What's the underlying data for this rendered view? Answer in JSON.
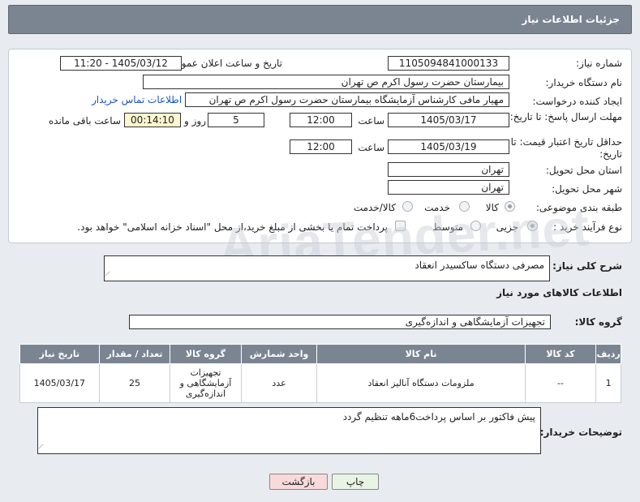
{
  "header": {
    "title": "جزئیات اطلاعات نیاز"
  },
  "form": {
    "need_number_label": "شماره نیاز:",
    "need_number": "1105094841000133",
    "announce_label": "تاریخ و ساعت اعلان عمومی:",
    "announce_value": "1405/03/12 - 11:20",
    "buyer_org_label": "نام دستگاه خریدار:",
    "buyer_org": "بیمارستان حضرت رسول اکرم ص  تهران",
    "creator_label": "ایجاد کننده درخواست:",
    "creator": "مهیار مافی کارشناس آزمایشگاه بیمارستان حضرت رسول اکرم ص  تهران",
    "contact_link": "اطلاعات تماس خریدار",
    "reply_deadline_label": "مهلت ارسال پاسخ: تا تاریخ:",
    "reply_date": "1405/03/17",
    "time_label": "ساعت",
    "reply_time": "12:00",
    "days": "5",
    "days_label": "روز و",
    "remaining": "00:14:10",
    "remaining_label": "ساعت باقی مانده",
    "price_valid_label": "حداقل تاریخ اعتبار قیمت: تا تاریخ:",
    "price_valid_date": "1405/03/19",
    "price_valid_time": "12:00",
    "province_label": "استان محل تحویل:",
    "province": "تهران",
    "city_label": "شهر محل تحویل:",
    "city": "تهران",
    "category_label": "طبقه بندی موضوعی:",
    "category_options": [
      "کالا",
      "خدمت",
      "کالا/خدمت"
    ],
    "process_label": "نوع فرآیند خرید :",
    "process_options": [
      "جزیی",
      "متوسط"
    ],
    "payment_note": "پرداخت تمام یا بخشی از مبلغ خرید،از محل \"اسناد خزانه اسلامی\" خواهد بود."
  },
  "watermark": "AriaTender.net",
  "summary": {
    "label": "شرح کلی نیاز:",
    "text": "مصرفی دستگاه ساکسیدر انعقاد"
  },
  "goods_section_title": "اطلاعات کالاهای مورد نیاز",
  "goods_group": {
    "label": "گروه کالا:",
    "value": "تجهیزات آزمایشگاهی و اندازه‌گیری"
  },
  "table": {
    "headers": [
      "ردیف",
      "کد کالا",
      "نام کالا",
      "واحد شمارش",
      "گروه کالا",
      "تعداد / مقدار",
      "تاریخ نیاز"
    ],
    "rows": [
      [
        "1",
        "--",
        "ملزومات دستگاه آنالیز انعقاد",
        "عدد",
        "تجهیزات آزمایشگاهی و اندازه‌گیری",
        "25",
        "1405/03/17"
      ]
    ]
  },
  "buyer_notes": {
    "label": "توضیحات خریدار:",
    "text": "پیش فاکتور بر اساس پرداخت6ماهه تنظیم گردد"
  },
  "buttons": {
    "print": "چاپ",
    "back": "بازگشت"
  }
}
